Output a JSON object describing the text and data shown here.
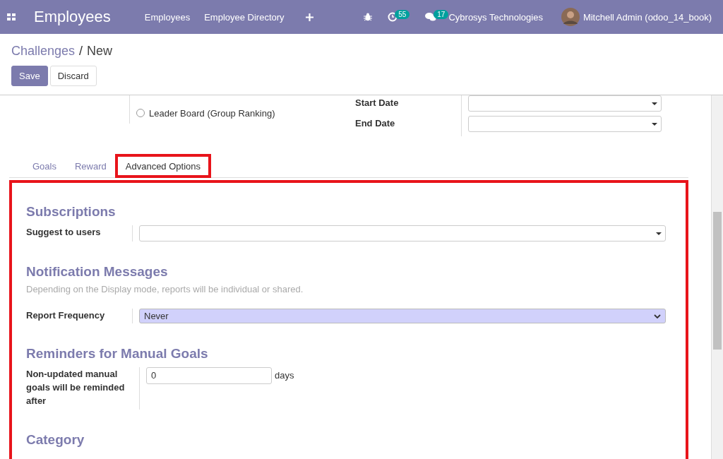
{
  "navbar": {
    "app_title": "Employees",
    "menu": [
      "Employees",
      "Employee Directory"
    ],
    "activity_count": "55",
    "message_count": "17",
    "company": "Cybrosys Technologies",
    "user": "Mitchell Admin (odoo_14_book)"
  },
  "breadcrumb": {
    "parent": "Challenges",
    "separator": "/",
    "current": "New"
  },
  "buttons": [
    {
      "label": "Save",
      "kind": "primary"
    },
    {
      "label": "Discard",
      "kind": "secondary"
    }
  ],
  "top_fields": {
    "radio": {
      "label": "Leader Board (Group Ranking)",
      "checked": false
    },
    "dates": [
      {
        "label": "Start Date"
      },
      {
        "label": "End Date"
      }
    ]
  },
  "tabs": [
    {
      "label": "Goals",
      "selected": false,
      "highlighted": false
    },
    {
      "label": "Reward",
      "selected": false,
      "highlighted": false
    },
    {
      "label": "Advanced Options",
      "selected": true,
      "highlighted": true
    }
  ],
  "panel": {
    "highlighted": true,
    "sections": [
      {
        "title": "Subscriptions",
        "fields": [
          {
            "kind": "many2one",
            "label": "Suggest to users"
          }
        ]
      },
      {
        "title": "Notification Messages",
        "help": "Depending on the Display mode, reports will be individual or shared.",
        "fields": [
          {
            "kind": "select",
            "label": "Report Frequency",
            "value": "Never"
          }
        ]
      },
      {
        "title": "Reminders for Manual Goals",
        "fields": [
          {
            "kind": "integer",
            "label": "Non-updated manual goals will be reminded after",
            "value": "0",
            "unit": "days"
          }
        ]
      },
      {
        "title": "Category"
      }
    ]
  }
}
